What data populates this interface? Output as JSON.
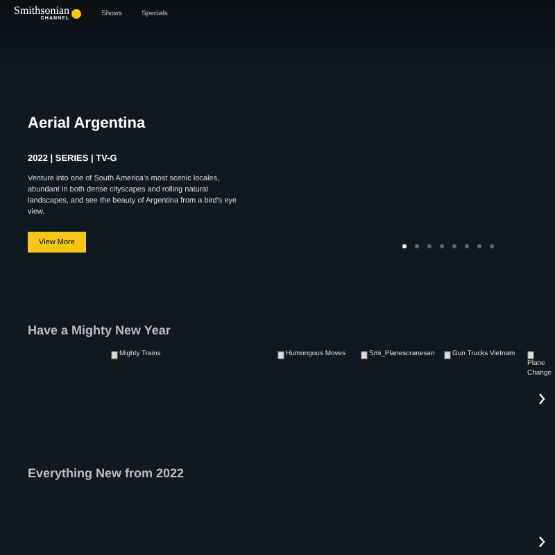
{
  "header": {
    "logo": {
      "name": "Smithsonian",
      "sub": "CHANNEL"
    },
    "nav": [
      {
        "label": "Shows"
      },
      {
        "label": "Specials"
      }
    ]
  },
  "hero": {
    "title": "Aerial Argentina",
    "meta": "2022 | SERIES | TV-G",
    "description": "Venture into one of South America's most scenic locales, abundant in both dense cityscapes and rolling natural landscapes, and see the beauty of Argentina from a bird's eye view.",
    "button": "View More",
    "dots": [
      {
        "selected": true
      },
      {
        "selected": false
      },
      {
        "selected": false
      },
      {
        "selected": false
      },
      {
        "selected": false
      },
      {
        "selected": false
      },
      {
        "selected": false
      },
      {
        "selected": false
      }
    ]
  },
  "rows": [
    {
      "title": "Have a Mighty New Year",
      "tiles": [
        {
          "alt": "Mighty Trains"
        },
        {
          "alt": "Humongous Moves"
        },
        {
          "alt": "Smi_Planescranesan"
        },
        {
          "alt": "Gun Trucks Vietnam"
        },
        {
          "alt": "Plane Change"
        }
      ]
    },
    {
      "title": "Everything New from 2022",
      "tiles": []
    }
  ]
}
